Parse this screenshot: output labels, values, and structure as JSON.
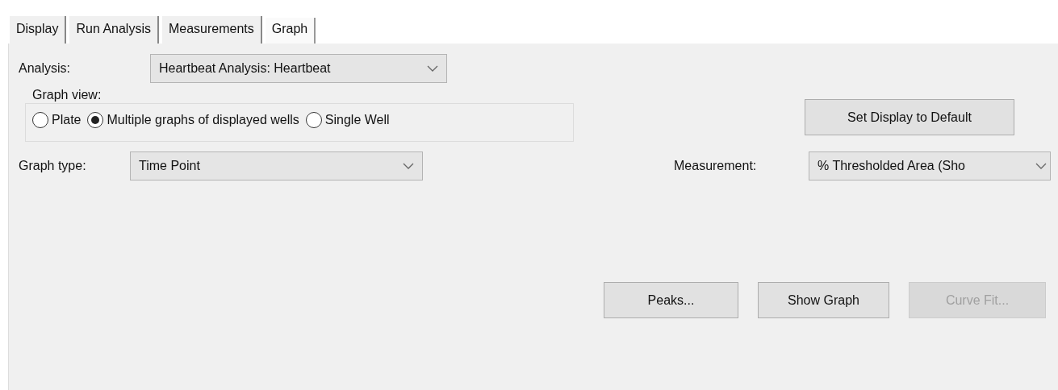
{
  "tabs": [
    {
      "label": "Display",
      "selected": false
    },
    {
      "label": "Run Analysis",
      "selected": false
    },
    {
      "label": "Measurements",
      "selected": false
    },
    {
      "label": "Graph",
      "selected": true
    }
  ],
  "analysis": {
    "label": "Analysis:",
    "value": "Heartbeat Analysis: Heartbeat"
  },
  "graph_view": {
    "legend": "Graph view:",
    "options": [
      {
        "label": "Plate",
        "selected": false
      },
      {
        "label": "Multiple graphs of displayed wells",
        "selected": true
      },
      {
        "label": "Single Well",
        "selected": false
      }
    ]
  },
  "set_default_button": {
    "label": "Set Display to Default"
  },
  "graph_type": {
    "label": "Graph type:",
    "value": "Time Point"
  },
  "measurement": {
    "label": "Measurement:",
    "value": "% Thresholded Area (Sho"
  },
  "buttons": [
    {
      "label": "Peaks...",
      "disabled": false
    },
    {
      "label": "Show Graph",
      "disabled": false
    },
    {
      "label": "Curve Fit...",
      "disabled": true
    }
  ]
}
